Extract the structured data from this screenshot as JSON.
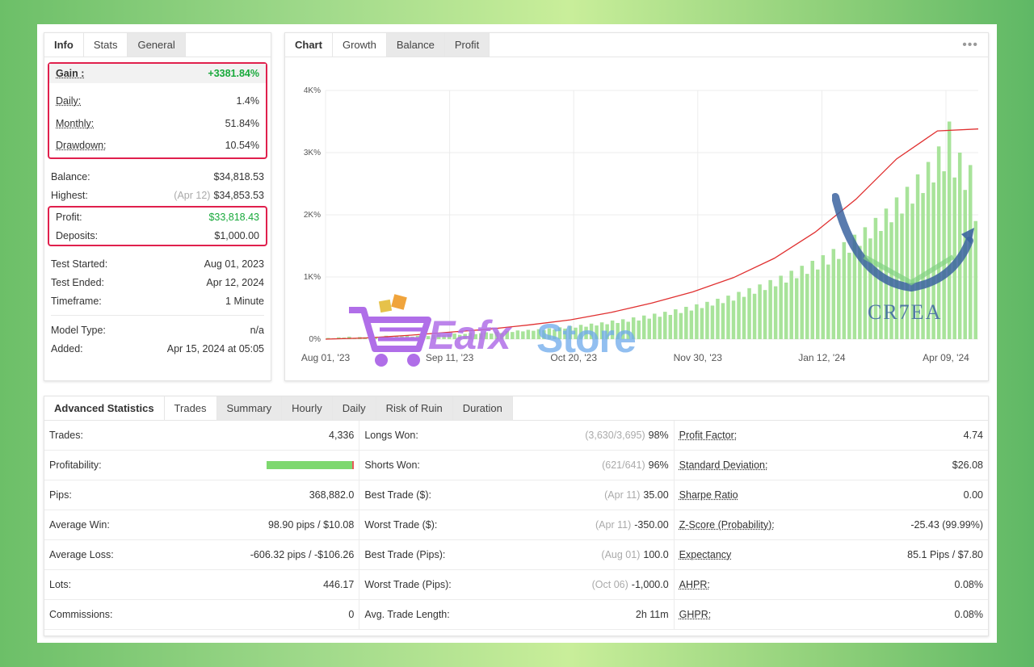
{
  "info": {
    "tabs": [
      "Info",
      "Stats",
      "General"
    ],
    "gain": {
      "label": "Gain :",
      "value": "+3381.84%"
    },
    "daily": {
      "label": "Daily:",
      "value": "1.4%"
    },
    "monthly": {
      "label": "Monthly:",
      "value": "51.84%"
    },
    "drawdown": {
      "label": "Drawdown:",
      "value": "10.54%"
    },
    "balance": {
      "label": "Balance:",
      "value": "$34,818.53"
    },
    "highest": {
      "label": "Highest:",
      "note": "(Apr 12)",
      "value": "$34,853.53"
    },
    "profit": {
      "label": "Profit:",
      "value": "$33,818.43"
    },
    "deposits": {
      "label": "Deposits:",
      "value": "$1,000.00"
    },
    "test_started": {
      "label": "Test Started:",
      "value": "Aug 01, 2023"
    },
    "test_ended": {
      "label": "Test Ended:",
      "value": "Apr 12, 2024"
    },
    "timeframe": {
      "label": "Timeframe:",
      "value": "1 Minute"
    },
    "model_type": {
      "label": "Model Type:",
      "value": "n/a"
    },
    "added": {
      "label": "Added:",
      "value": "Apr 15, 2024 at 05:05"
    }
  },
  "chart_panel": {
    "tabs": [
      "Chart",
      "Growth",
      "Balance",
      "Profit"
    ],
    "menu_glyph": "•••"
  },
  "chart_data": {
    "type": "line",
    "y_ticks": [
      "0%",
      "1K%",
      "2K%",
      "3K%",
      "4K%"
    ],
    "x_ticks": [
      "Aug 01, '23",
      "Sep 11, '23",
      "Oct 20, '23",
      "Nov 30, '23",
      "Jan 12, '24",
      "Apr 09, '24"
    ],
    "ylim": [
      0,
      4000
    ],
    "grid": true,
    "growth_line_color": "#e03030",
    "bar_color": "#a8e39a",
    "growth_points": [
      [
        0,
        0
      ],
      [
        10,
        20
      ],
      [
        20,
        60
      ],
      [
        30,
        110
      ],
      [
        40,
        160
      ],
      [
        50,
        230
      ],
      [
        60,
        310
      ],
      [
        70,
        430
      ],
      [
        80,
        580
      ],
      [
        90,
        760
      ],
      [
        100,
        990
      ],
      [
        110,
        1300
      ],
      [
        120,
        1720
      ],
      [
        130,
        2250
      ],
      [
        140,
        2900
      ],
      [
        150,
        3350
      ],
      [
        160,
        3380
      ]
    ],
    "bars": [
      20,
      15,
      30,
      25,
      40,
      20,
      35,
      30,
      45,
      25,
      40,
      55,
      35,
      50,
      45,
      60,
      40,
      55,
      70,
      50,
      65,
      80,
      60,
      75,
      90,
      70,
      85,
      100,
      80,
      95,
      110,
      90,
      120,
      100,
      130,
      115,
      140,
      125,
      150,
      135,
      160,
      145,
      175,
      155,
      190,
      170,
      210,
      185,
      230,
      200,
      250,
      220,
      270,
      240,
      300,
      260,
      320,
      280,
      350,
      300,
      380,
      330,
      410,
      360,
      440,
      390,
      480,
      420,
      520,
      460,
      560,
      500,
      600,
      540,
      650,
      580,
      700,
      620,
      760,
      680,
      820,
      730,
      880,
      790,
      950,
      850,
      1020,
      910,
      1100,
      980,
      1180,
      1050,
      1260,
      1120,
      1350,
      1200,
      1450,
      1290,
      1560,
      1390,
      1680,
      1500,
      1800,
      1620,
      1950,
      1740,
      2100,
      1880,
      2280,
      2020,
      2450,
      2180,
      2650,
      2350,
      2850,
      2520,
      3100,
      2700,
      3500,
      2600,
      3000,
      2400,
      2800,
      1900
    ]
  },
  "advanced": {
    "tabs": [
      "Advanced Statistics",
      "Trades",
      "Summary",
      "Hourly",
      "Daily",
      "Risk of Ruin",
      "Duration"
    ],
    "col1": [
      {
        "label": "Trades:",
        "value": "4,336"
      },
      {
        "label": "Profitability:",
        "value": ""
      },
      {
        "label": "Pips:",
        "value": "368,882.0"
      },
      {
        "label": "Average Win:",
        "value": "98.90 pips / $10.08"
      },
      {
        "label": "Average Loss:",
        "value": "-606.32 pips / -$106.26"
      },
      {
        "label": "Lots:",
        "value": "446.17"
      },
      {
        "label": "Commissions:",
        "value": "0"
      }
    ],
    "profitability_win_share": 0.98,
    "col2": [
      {
        "label": "Longs Won:",
        "note": "(3,630/3,695)",
        "value": "98%"
      },
      {
        "label": "Shorts Won:",
        "note": "(621/641)",
        "value": "96%"
      },
      {
        "label": "Best Trade ($):",
        "note": "(Apr 11)",
        "value": "35.00"
      },
      {
        "label": "Worst Trade ($):",
        "note": "(Apr 11)",
        "value": "-350.00"
      },
      {
        "label": "Best Trade (Pips):",
        "note": "(Aug 01)",
        "value": "100.0"
      },
      {
        "label": "Worst Trade (Pips):",
        "note": "(Oct 06)",
        "value": "-1,000.0"
      },
      {
        "label": "Avg. Trade Length:",
        "note": "",
        "value": "2h 11m"
      }
    ],
    "col3": [
      {
        "label": "Profit Factor:",
        "value": "4.74"
      },
      {
        "label": "Standard Deviation:",
        "value": "$26.08"
      },
      {
        "label": "Sharpe Ratio",
        "value": "0.00"
      },
      {
        "label": "Z-Score (Probability):",
        "value": "-25.43 (99.99%)"
      },
      {
        "label": "Expectancy",
        "value": "85.1 Pips / $7.80"
      },
      {
        "label": "AHPR:",
        "value": "0.08%"
      },
      {
        "label": "GHPR:",
        "value": "0.08%"
      }
    ]
  },
  "watermarks": {
    "store_a": "Eafx",
    "store_b": "Store",
    "brand": "CR7EA"
  }
}
